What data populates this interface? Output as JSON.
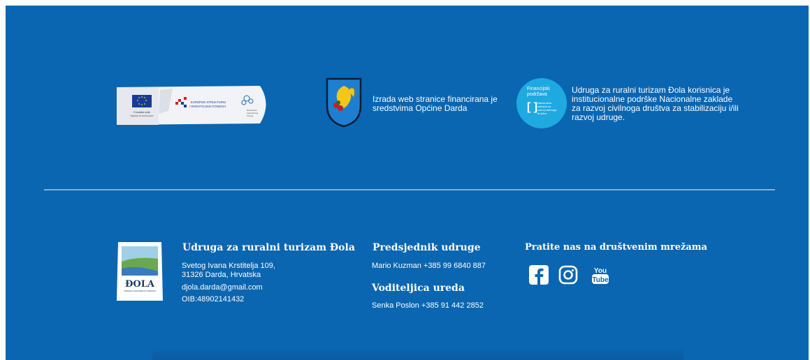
{
  "sponsors": {
    "eu_banner": {
      "eu_text": "Europska unija\n\"Zajedno do fondova EU\"",
      "esif_line1": "EUROPSKI STRUKTURNI",
      "esif_line2": "I INVESTICIJSKI FONDOVI",
      "side_text": "Ministarstvo\nregionalnoga\nrazvoja i fondova\nEuropske unije"
    },
    "darda": {
      "text": "Izrada web stranice financirana je sredstvima Općine Darda"
    },
    "nzcd": {
      "badge_line1": "Financijski",
      "badge_line2": "podržava",
      "badge_small": "Nacionalna zaklada za razvoj civilnoga društva",
      "text": "Udruga za ruralni turizam Đola korisnica je institucionalne podrške Nacionalne zaklade za razvoj civilnoga društva za stabilizaciju i/ili razvoj udruge."
    }
  },
  "organization": {
    "stamp_text": "ĐOLA",
    "title": "Udruga za ruralni turizam Đola",
    "address": "Svetog Ivana Krstitelja 109,\n31326 Darda, Hrvatska",
    "email": "djola.darda@gmail.com",
    "oib": "OIB:48902141432"
  },
  "president": {
    "title": "Predsjednik udruge",
    "contact": "Mario Kuzman +385 99 6840 887"
  },
  "manager": {
    "title": "Voditeljica ureda",
    "contact": "Senka Poslon +385 91 442 2852"
  },
  "social": {
    "title": "Pratite nas na društvenim mrežama",
    "icons": [
      "facebook-icon",
      "instagram-icon",
      "youtube-icon"
    ]
  },
  "colors": {
    "background": "#0a66b1",
    "badge": "#1fa9e1",
    "divider": "#7fb0d9"
  }
}
